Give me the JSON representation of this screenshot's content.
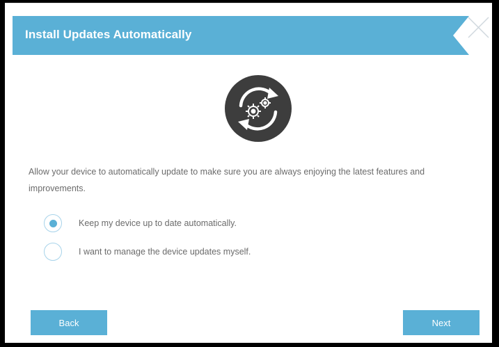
{
  "dialog": {
    "title": "Install Updates Automatically",
    "close_icon": "close-icon",
    "center_icon": "auto-update-icon",
    "description": "Allow your device to automatically update to make sure you are always enjoying the latest features and improvements.",
    "options": [
      {
        "label": "Keep my device up to date automatically.",
        "selected": true
      },
      {
        "label": "I want to manage the device updates myself.",
        "selected": false
      }
    ],
    "back_label": "Back",
    "next_label": "Next"
  },
  "colors": {
    "accent": "#5ab0d6",
    "radio_border": "#a7d3ea",
    "text": "#6b6b6b",
    "icon_bg": "#3d3d3d"
  }
}
